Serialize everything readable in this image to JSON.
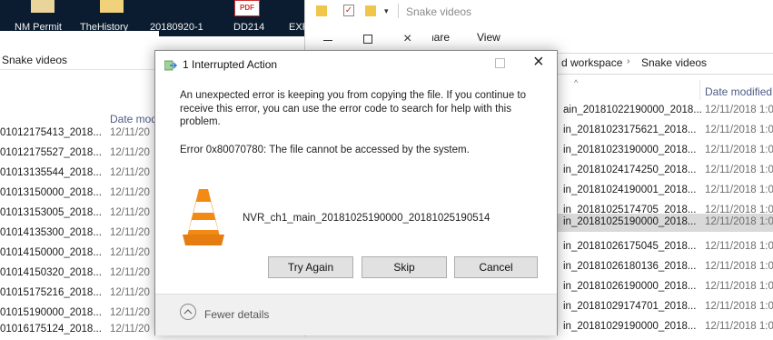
{
  "desktop": {
    "labels": [
      "NM Permit",
      "TheHistory",
      "20180920-1",
      "DD214",
      "EXPL"
    ],
    "pdf_badge": "PDF"
  },
  "left_explorer": {
    "address": "Snake videos",
    "column_date": "Date mod",
    "rows": [
      {
        "name": "01012175413_2018...",
        "date": "12/11/20"
      },
      {
        "name": "01012175527_2018...",
        "date": "12/11/20"
      },
      {
        "name": "01013135544_2018...",
        "date": "12/11/20"
      },
      {
        "name": "01013150000_2018...",
        "date": "12/11/20"
      },
      {
        "name": "01013153005_2018...",
        "date": "12/11/20"
      },
      {
        "name": "01014135300_2018...",
        "date": "12/11/20"
      },
      {
        "name": "01014150000_2018...",
        "date": "12/11/20"
      },
      {
        "name": "01014150320_2018...",
        "date": "12/11/20"
      },
      {
        "name": "01015175216_2018...",
        "date": "12/11/20"
      },
      {
        "name": "01015190000_2018...",
        "date": "12/11/20"
      },
      {
        "name": "01016175124_2018...",
        "date": "12/11/20"
      }
    ]
  },
  "right_explorer": {
    "title": "Snake videos",
    "ribbon_tabs": [
      "Share",
      "View"
    ],
    "breadcrumb": [
      "d workspace",
      "Snake videos"
    ],
    "column_date": "Date modified",
    "rows": [
      {
        "name": "ain_20181022190000_2018...",
        "date": "12/11/2018 1:0",
        "selected": false
      },
      {
        "name": "in_20181023175621_2018...",
        "date": "12/11/2018 1:0",
        "selected": false
      },
      {
        "name": "in_20181023190000_2018...",
        "date": "12/11/2018 1:0",
        "selected": false
      },
      {
        "name": "in_20181024174250_2018...",
        "date": "12/11/2018 1:0",
        "selected": false
      },
      {
        "name": "in_20181024190001_2018...",
        "date": "12/11/2018 1:0",
        "selected": false
      },
      {
        "name": "in_20181025174705_2018...",
        "date": "12/11/2018 1:0",
        "selected": false
      },
      {
        "name": "in_20181025190000_2018...",
        "date": "12/11/2018 1:0",
        "selected": true
      },
      {
        "name": "in_20181026175045_2018...",
        "date": "12/11/2018 1:0",
        "selected": false
      },
      {
        "name": "in_20181026180136_2018...",
        "date": "12/11/2018 1:0",
        "selected": false
      },
      {
        "name": "in_20181026190000_2018...",
        "date": "12/11/2018 1:0",
        "selected": false
      },
      {
        "name": "in_20181029174701_2018...",
        "date": "12/11/2018 1:0",
        "selected": false
      },
      {
        "name": "in_20181029190000_2018...",
        "date": "12/11/2018 1:0",
        "selected": false
      }
    ]
  },
  "dialog": {
    "title": "1 Interrupted Action",
    "message": "An unexpected error is keeping you from copying the file. If you continue to receive this error, you can use the error code to search for help with this problem.",
    "error": "Error 0x80070780: The file cannot be accessed by the system.",
    "file_name": "NVR_ch1_main_20181025190000_20181025190514",
    "buttons": {
      "try_again": "Try Again",
      "skip": "Skip",
      "cancel": "Cancel"
    },
    "fewer_details": "Fewer details"
  }
}
